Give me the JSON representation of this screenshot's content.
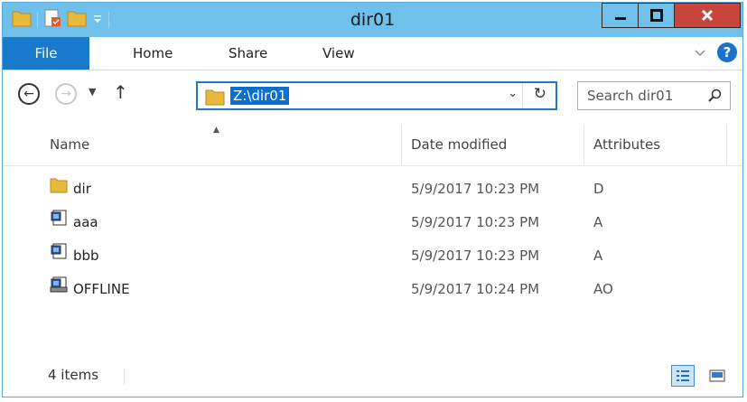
{
  "window": {
    "title": "dir01"
  },
  "ribbon": {
    "tabs": [
      {
        "label": "File"
      },
      {
        "label": "Home"
      },
      {
        "label": "Share"
      },
      {
        "label": "View"
      }
    ],
    "help_icon": "?"
  },
  "nav": {
    "address": "Z:\\dir01",
    "search_placeholder": "Search dir01"
  },
  "columns": {
    "name": "Name",
    "date": "Date modified",
    "attributes": "Attributes"
  },
  "files": [
    {
      "name": "dir",
      "date": "5/9/2017 10:23 PM",
      "attributes": "D",
      "icon": "folder-icon"
    },
    {
      "name": "aaa",
      "date": "5/9/2017 10:23 PM",
      "attributes": "A",
      "icon": "file-icon"
    },
    {
      "name": "bbb",
      "date": "5/9/2017 10:23 PM",
      "attributes": "A",
      "icon": "file-icon"
    },
    {
      "name": "OFFLINE",
      "date": "5/9/2017 10:24 PM",
      "attributes": "AO",
      "icon": "offline-file-icon"
    }
  ],
  "status": {
    "item_count": "4 items"
  },
  "colors": {
    "titlebar": "#6fc0ea",
    "file_tab": "#1979ca",
    "close_button": "#c7453b",
    "selection": "#0a6fd1",
    "folder": "#e8b93c"
  }
}
